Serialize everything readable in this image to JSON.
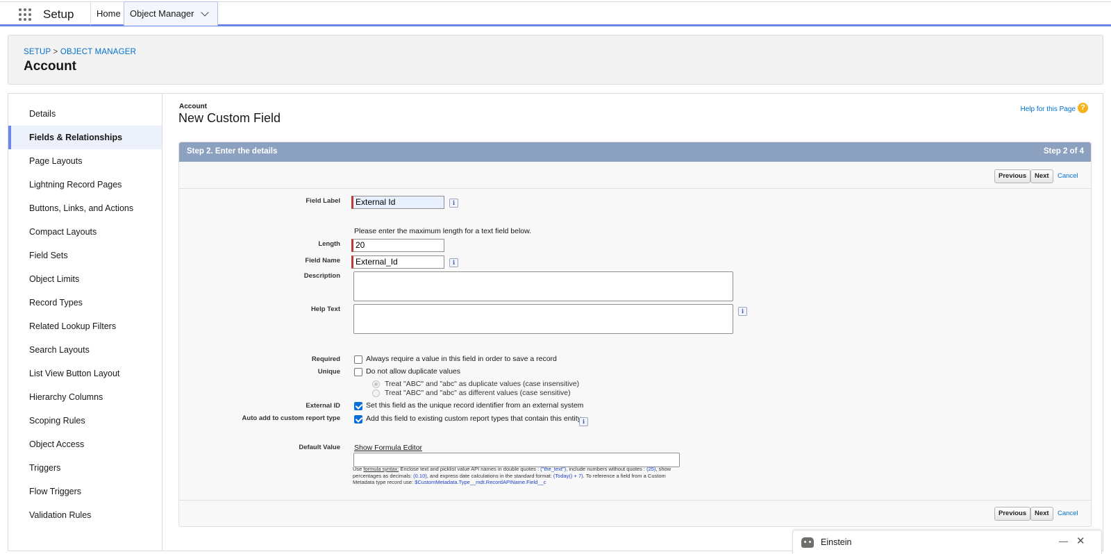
{
  "topnav": {
    "app_name": "Setup",
    "home_tab": "Home",
    "object_manager_tab": "Object Manager"
  },
  "header": {
    "breadcrumb": {
      "setup": "SETUP",
      "separator": ">",
      "object_manager": "OBJECT MANAGER"
    },
    "title": "Account"
  },
  "sidebar": {
    "items": [
      {
        "label": "Details"
      },
      {
        "label": "Fields & Relationships",
        "active": true
      },
      {
        "label": "Page Layouts"
      },
      {
        "label": "Lightning Record Pages"
      },
      {
        "label": "Buttons, Links, and Actions"
      },
      {
        "label": "Compact Layouts"
      },
      {
        "label": "Field Sets"
      },
      {
        "label": "Object Limits"
      },
      {
        "label": "Record Types"
      },
      {
        "label": "Related Lookup Filters"
      },
      {
        "label": "Search Layouts"
      },
      {
        "label": "List View Button Layout"
      },
      {
        "label": "Hierarchy Columns"
      },
      {
        "label": "Scoping Rules"
      },
      {
        "label": "Object Access"
      },
      {
        "label": "Triggers"
      },
      {
        "label": "Flow Triggers"
      },
      {
        "label": "Validation Rules"
      }
    ]
  },
  "content": {
    "object_name": "Account",
    "title": "New Custom Field",
    "help_link": "Help for this Page",
    "help_icon": "?",
    "step_label": "Step 2. Enter the details",
    "step_count": "Step 2 of 4",
    "buttons": {
      "previous": "Previous",
      "next": "Next",
      "cancel": "Cancel"
    }
  },
  "form": {
    "field_label": {
      "label": "Field Label",
      "value": "External Id"
    },
    "length_hint": "Please enter the maximum length for a text field below.",
    "length": {
      "label": "Length",
      "value": "20"
    },
    "field_name": {
      "label": "Field Name",
      "value": "External_Id"
    },
    "description": {
      "label": "Description",
      "value": ""
    },
    "help_text": {
      "label": "Help Text",
      "value": ""
    },
    "required": {
      "label": "Required",
      "checkbox": "Always require a value in this field in order to save a record",
      "checked": false
    },
    "unique": {
      "label": "Unique",
      "checkbox": "Do not allow duplicate values",
      "checked": false,
      "options": [
        "Treat \"ABC\" and \"abc\" as duplicate values (case insensitive)",
        "Treat \"ABC\" and \"abc\" as different values (case sensitive)"
      ]
    },
    "external_id": {
      "label": "External ID",
      "checkbox": "Set this field as the unique record identifier from an external system",
      "checked": true
    },
    "auto_add": {
      "label": "Auto add to custom report type",
      "checkbox": "Add this field to existing custom report types that contain this entity",
      "checked": true
    },
    "default_value": {
      "label": "Default Value",
      "link": "Show Formula Editor",
      "value": "",
      "help": {
        "use": "Use ",
        "syntax_link": "formula syntax:",
        "t1": " Enclose text and picklist value API names in double quotes : ",
        "ex1": "(\"the_text\")",
        "t2": ", include numbers without quotes : ",
        "ex2": "(25)",
        "t3": ", show percentages as decimals: ",
        "ex3": "(0.10)",
        "t4": ", and express date calculations in the standard format: ",
        "ex4": "(Today() + 7)",
        "t5": ". To reference a field from a Custom Metadata type record use: ",
        "ex5": "$CustomMetadata.Type__mdt.RecordAPIName.Field__c"
      }
    },
    "info_glyph": "i"
  },
  "einstein": {
    "label": "Einstein",
    "minimize": "—",
    "close": "✕"
  }
}
